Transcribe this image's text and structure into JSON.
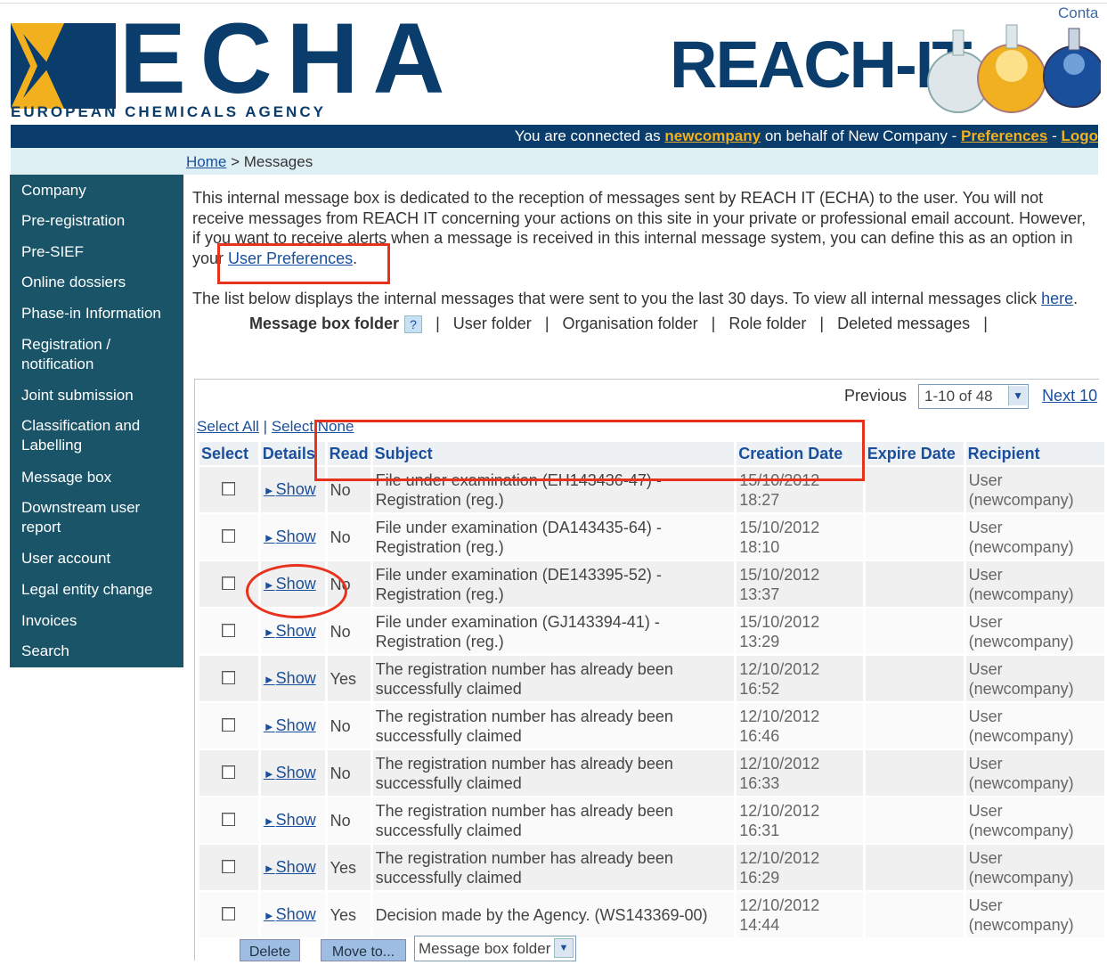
{
  "header": {
    "logo_text": "ECHA",
    "logo_subtitle": "EUROPEAN CHEMICALS AGENCY",
    "app_title": "REACH-IT",
    "contact_link": "Conta"
  },
  "connection": {
    "prefix": "You are connected as ",
    "username": "newcompany",
    "middle": " on behalf of New Company - ",
    "preferences": "Preferences",
    "dash": " - ",
    "logout": "Logo"
  },
  "breadcrumb": {
    "home": "Home",
    "separator": " > ",
    "current": "Messages"
  },
  "sidebar": {
    "items": [
      {
        "label": "Company"
      },
      {
        "label": "Pre-registration"
      },
      {
        "label": "Pre-SIEF"
      },
      {
        "label": "Online dossiers"
      },
      {
        "label": "Phase-in Information"
      },
      {
        "label": "Registration / notification"
      },
      {
        "label": "Joint submission"
      },
      {
        "label": "Classification and Labelling"
      },
      {
        "label": "Message box"
      },
      {
        "label": "Downstream user report"
      },
      {
        "label": "User account"
      },
      {
        "label": "Legal entity change"
      },
      {
        "label": "Invoices"
      },
      {
        "label": "Search"
      }
    ]
  },
  "intro": {
    "text": "This internal message box is dedicated to the reception of messages sent by REACH IT (ECHA) to the user. You will not receive messages from REACH IT concerning your actions on this site in your private or professional email account. However, if you want to receive alerts when a message is received in this internal message system, you can define this as an option in your ",
    "link": "User Preferences",
    "end": ".",
    "list_note": "The list below displays the internal messages that were sent to you the last 30 days. To view all internal messages click ",
    "list_link": "here",
    "list_end": "."
  },
  "folders": {
    "current": "Message box folder",
    "help": "?",
    "sep": "|",
    "user": "User folder",
    "organisation": "Organisation folder",
    "role": "Role folder",
    "deleted": "Deleted messages"
  },
  "pager": {
    "previous": "Previous",
    "range": "1-10 of 48",
    "next": "Next 10"
  },
  "selection": {
    "all": "Select All",
    "sep": " | ",
    "none": "Select None"
  },
  "table": {
    "headers": {
      "select": "Select",
      "details": "Details",
      "read": "Read",
      "subject": "Subject",
      "created": "Creation Date",
      "expire": "Expire Date",
      "recipient": "Recipient"
    },
    "show_label": "Show",
    "show_arrow": "►",
    "rows": [
      {
        "read": "No",
        "subject": "File under examination (EH143436-47) - Registration (reg.)",
        "created_date": "15/10/2012",
        "created_time": "18:27",
        "expire": "",
        "recipient_role": "User",
        "recipient_name": "(newcompany)"
      },
      {
        "read": "No",
        "subject": "File under examination (DA143435-64) - Registration (reg.)",
        "created_date": "15/10/2012",
        "created_time": "18:10",
        "expire": "",
        "recipient_role": "User",
        "recipient_name": "(newcompany)"
      },
      {
        "read": "No",
        "subject": "File under examination (DE143395-52) - Registration (reg.)",
        "created_date": "15/10/2012",
        "created_time": "13:37",
        "expire": "",
        "recipient_role": "User",
        "recipient_name": "(newcompany)"
      },
      {
        "read": "No",
        "subject": "File under examination (GJ143394-41) - Registration (reg.)",
        "created_date": "15/10/2012",
        "created_time": "13:29",
        "expire": "",
        "recipient_role": "User",
        "recipient_name": "(newcompany)"
      },
      {
        "read": "Yes",
        "subject": "The registration number has already been successfully claimed",
        "created_date": "12/10/2012",
        "created_time": "16:52",
        "expire": "",
        "recipient_role": "User",
        "recipient_name": "(newcompany)"
      },
      {
        "read": "No",
        "subject": "The registration number has already been successfully claimed",
        "created_date": "12/10/2012",
        "created_time": "16:46",
        "expire": "",
        "recipient_role": "User",
        "recipient_name": "(newcompany)"
      },
      {
        "read": "No",
        "subject": "The registration number has already been successfully claimed",
        "created_date": "12/10/2012",
        "created_time": "16:33",
        "expire": "",
        "recipient_role": "User",
        "recipient_name": "(newcompany)"
      },
      {
        "read": "No",
        "subject": "The registration number has already been successfully claimed",
        "created_date": "12/10/2012",
        "created_time": "16:31",
        "expire": "",
        "recipient_role": "User",
        "recipient_name": "(newcompany)"
      },
      {
        "read": "Yes",
        "subject": "The registration number has already been successfully claimed",
        "created_date": "12/10/2012",
        "created_time": "16:29",
        "expire": "",
        "recipient_role": "User",
        "recipient_name": "(newcompany)"
      },
      {
        "read": "Yes",
        "subject": "Decision made by the Agency. (WS143369-00)",
        "created_date": "12/10/2012",
        "created_time": "14:44",
        "expire": "",
        "recipient_role": "User",
        "recipient_name": "(newcompany)"
      }
    ]
  },
  "actions": {
    "delete": "Delete",
    "move": "Move to...",
    "folder_select": "Message box folder"
  },
  "colors": {
    "navy": "#0a3d6b",
    "sidebar": "#1a5468",
    "link": "#1a4f9c",
    "highlight": "#f2b01e",
    "annotation": "#e8321e"
  }
}
